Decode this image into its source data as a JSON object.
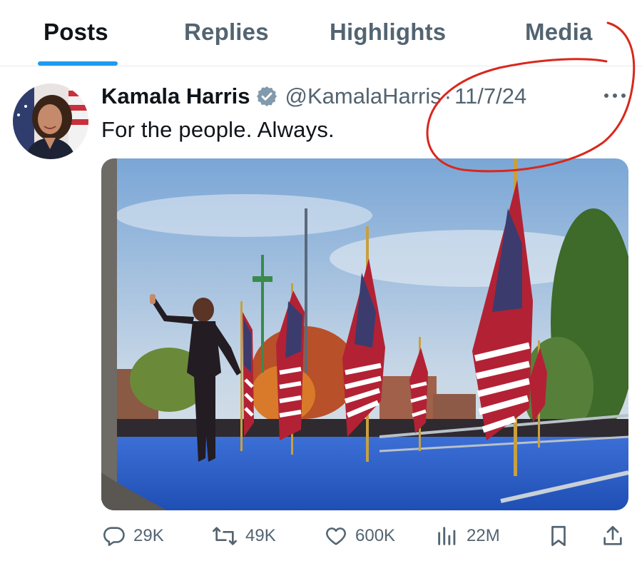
{
  "tabs": [
    {
      "label": "Posts",
      "active": true
    },
    {
      "label": "Replies",
      "active": false
    },
    {
      "label": "Highlights",
      "active": false
    },
    {
      "label": "Media",
      "active": false
    }
  ],
  "accent_color": "#1d9bf0",
  "annotation_color": "#d8281c",
  "post": {
    "author_name": "Kamala Harris",
    "verified_icon": "verified-badge-icon",
    "handle": "@KamalaHarris",
    "separator": "·",
    "date": "11/7/24",
    "text": "For the people. Always."
  },
  "actions": {
    "replies": "29K",
    "reposts": "49K",
    "likes": "600K",
    "views": "22M"
  }
}
